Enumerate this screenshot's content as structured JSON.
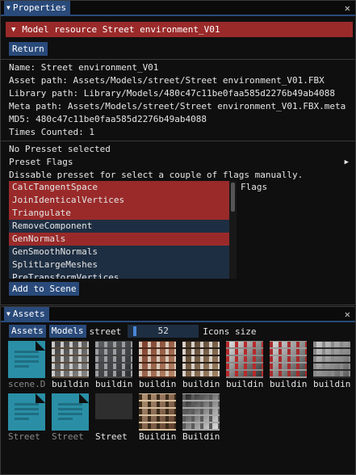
{
  "properties": {
    "tab_label": "Properties",
    "close": "✕",
    "header": "Model resource Street environment_V01",
    "return_label": "Return",
    "info": [
      "Name: Street environment_V01",
      "Asset path: Assets/Models/street/Street environment_V01.FBX",
      "Library path: Library/Models/480c47c11be0faa585d2276b49ab4088",
      "Meta path: Assets/Models/street/Street environment_V01.FBX.meta",
      "MD5: 480c47c11be0faa585d2276b49ab4088",
      "Times Counted: 1"
    ],
    "preset_status": "No Presset selected",
    "preset_flags_label": "Preset Flags",
    "dissable_hint": "Dissable presset for select a couple of flags manually.",
    "flags_label": "Flags",
    "flags": [
      {
        "label": "CalcTangentSpace",
        "selected": true
      },
      {
        "label": "JoinIdenticalVertices",
        "selected": true
      },
      {
        "label": "Triangulate",
        "selected": true
      },
      {
        "label": "RemoveComponent",
        "selected": false
      },
      {
        "label": "GenNormals",
        "selected": true
      },
      {
        "label": "GenSmoothNormals",
        "selected": false
      },
      {
        "label": "SplitLargeMeshes",
        "selected": false
      },
      {
        "label": "PreTransformVertices",
        "selected": false
      }
    ],
    "add_to_scene_label": "Add to Scene"
  },
  "assets": {
    "tab_label": "Assets",
    "close": "✕",
    "breadcrumb": [
      "Assets",
      "Models",
      "street"
    ],
    "icon_size_value": "52",
    "icon_size_fraction": 0.06,
    "icon_size_label": "Icons size",
    "items": [
      {
        "name": "scene.D",
        "kind": "doc",
        "dim": true
      },
      {
        "name": "buildin",
        "kind": "texture",
        "palette": [
          "#3a3a3a",
          "#8a8a8a",
          "#c8c8c8",
          "#5a4a3a"
        ]
      },
      {
        "name": "buildin",
        "kind": "texture",
        "palette": [
          "#5e6264",
          "#2a2c2e",
          "#9a9ea0",
          "#444"
        ]
      },
      {
        "name": "buildin",
        "kind": "texture",
        "palette": [
          "#7a3a2a",
          "#b88a6a",
          "#d8c8b8",
          "#4a2a1a"
        ]
      },
      {
        "name": "buildin",
        "kind": "texture",
        "palette": [
          "#4a3a2a",
          "#a88868",
          "#d8d0c8",
          "#2a2018"
        ]
      },
      {
        "name": "buildin",
        "kind": "texture",
        "palette": [
          "#e8e8e8",
          "#2a2a2a",
          "#b82a2a",
          "#8a8a8a"
        ]
      },
      {
        "name": "buildin",
        "kind": "texture",
        "palette": [
          "#e0e0e0",
          "#3a3a3a",
          "#a82a2a",
          "#9a9a9a"
        ]
      },
      {
        "name": "buildin",
        "kind": "texture",
        "palette": [
          "#d0d0d0",
          "#5a5a5a",
          "#8a8a8a",
          "#2a2a2a"
        ]
      },
      {
        "name": "Street",
        "kind": "doc",
        "dim": true
      },
      {
        "name": "Street",
        "kind": "doc",
        "dim": true
      },
      {
        "name": "Street",
        "kind": "dark",
        "dim": false
      },
      {
        "name": "Buildin",
        "kind": "texture",
        "palette": [
          "#b89878",
          "#5a3a2a",
          "#3a2a1a",
          "#d8c0a0"
        ]
      },
      {
        "name": "Buildin",
        "kind": "texture",
        "palette": [
          "#1a1a1a",
          "#e8e8e8",
          "#5a5a5a",
          "#a8a8a8"
        ]
      }
    ]
  },
  "colors": {
    "accent": "#294a7a",
    "selection": "#9a2a2a",
    "list_bg": "#1e2e42",
    "doc_icon": "#2a8fa6"
  }
}
